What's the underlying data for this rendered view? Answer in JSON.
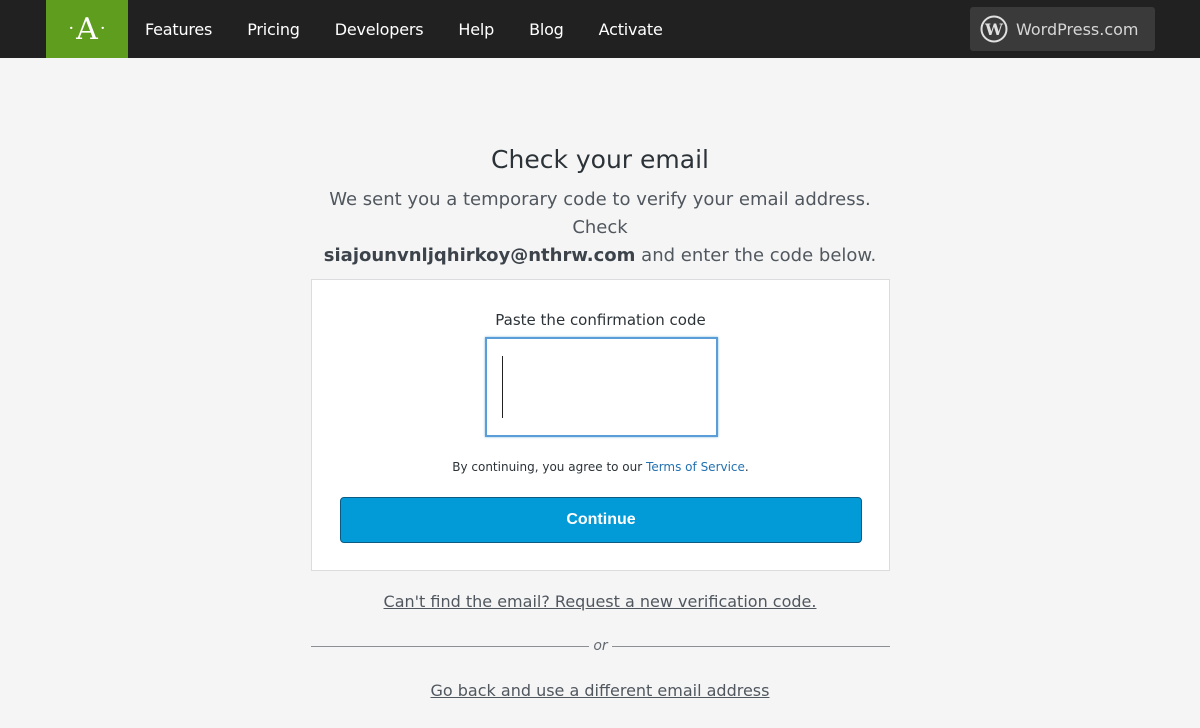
{
  "header": {
    "logo_text": "A",
    "nav": [
      {
        "label": "Features"
      },
      {
        "label": "Pricing"
      },
      {
        "label": "Developers"
      },
      {
        "label": "Help"
      },
      {
        "label": "Blog"
      },
      {
        "label": "Activate"
      }
    ],
    "wordpress_button": {
      "label": "WordPress.com",
      "icon": "wordpress-icon"
    }
  },
  "main": {
    "title": "Check your email",
    "subtitle_before": "We sent you a temporary code to verify your email address. Check",
    "email": "siajounvnljqhirkoy@nthrw.com",
    "subtitle_after": "and enter the code below.",
    "card": {
      "code_label": "Paste the confirmation code",
      "code_value": "",
      "code_placeholder": "",
      "tos_prefix": "By continuing, you agree to our",
      "tos_link": "Terms of Service",
      "tos_suffix": ".",
      "continue_label": "Continue"
    },
    "resend_link": "Can't find the email? Request a new verification code.",
    "divider_text": "or",
    "back_link": "Go back and use a different email address"
  },
  "colors": {
    "brand_green": "#5e9d1d",
    "topbar": "#212121",
    "primary_button": "#039ad8",
    "link_blue": "#2271b1"
  }
}
